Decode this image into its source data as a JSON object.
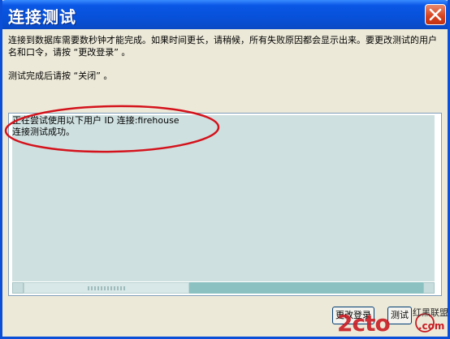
{
  "window": {
    "title": "连接测试",
    "message_line1": "连接到数据库需要数秒钟才能完成。如果时间更长，请稍候，所有失败原因都会显示出来。要更改测试的用户",
    "message_line2": "名和口令，请按 “更改登录” 。",
    "message_line3": "测试完成后请按 “关闭” 。"
  },
  "log": {
    "lines": [
      "正在尝试使用以下用户 ID 连接:firehouse",
      "连接测试成功。"
    ]
  },
  "buttons": {
    "change_login": "更改登录",
    "test": "测试"
  },
  "watermark": {
    "brand": "2cto",
    "domain": ".com",
    "site_name": "红黑联盟"
  },
  "colors": {
    "title_bar": "#0751d9",
    "annotation": "#d4121b",
    "log_bg": "#cfe0e0"
  }
}
